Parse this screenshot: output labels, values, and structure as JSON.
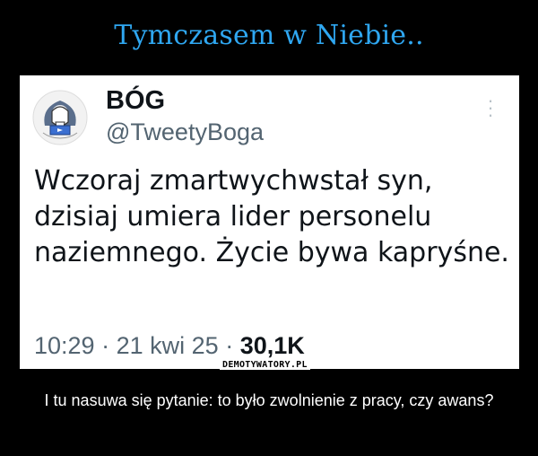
{
  "header": {
    "title": "Tymczasem w Niebie.."
  },
  "tweet": {
    "display_name": "BÓG",
    "handle": "@TweetyBoga",
    "more_icon": "more-vertical-icon",
    "text": "Wczoraj zmartwychwstał syn, dzisiaj umiera lider personelu naziemnego. Życie bywa kapryśne.",
    "time": "10:29",
    "separator": "·",
    "date": "21 kwi 25",
    "views": "30,1K"
  },
  "watermark": "DEMOTYWATORY.PL",
  "caption": "I tu nasuwa się pytanie: to było zwolnienie z pracy, czy awans?",
  "colors": {
    "title": "#2fa7f1",
    "background": "#000000",
    "card": "#ffffff",
    "muted": "#536471"
  }
}
